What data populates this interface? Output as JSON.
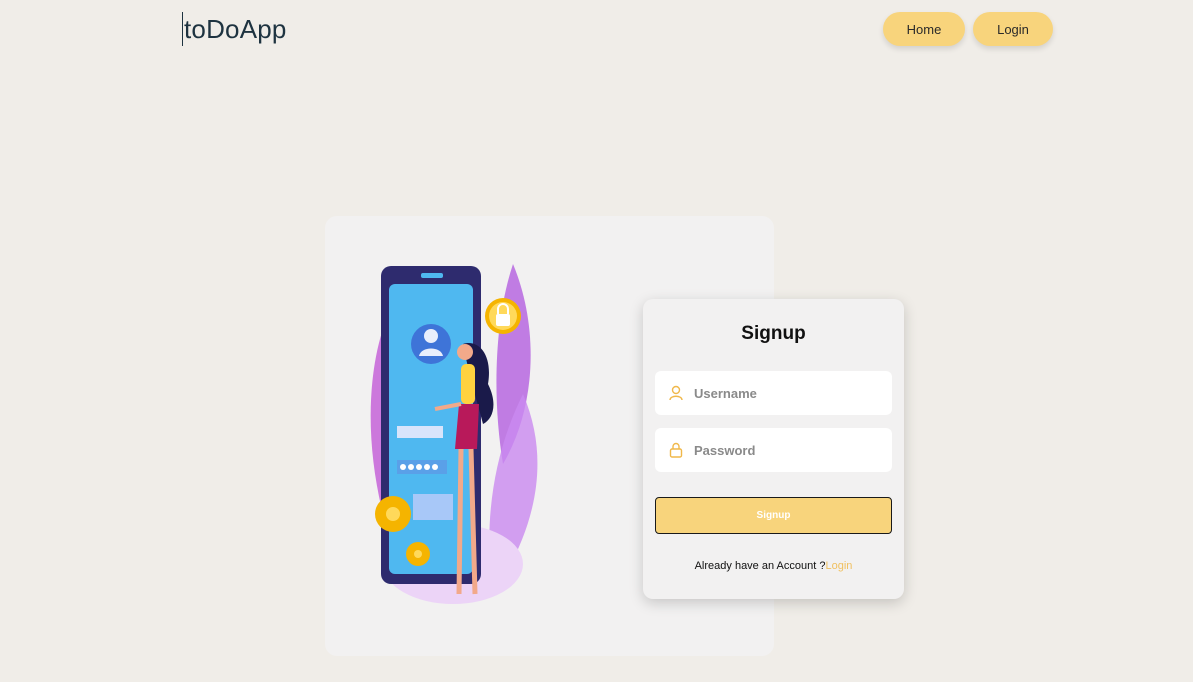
{
  "header": {
    "brand": "toDoApp",
    "nav": {
      "home_label": "Home",
      "login_label": "Login"
    }
  },
  "signup_form": {
    "title": "Signup",
    "username": {
      "placeholder": "Username",
      "value": "",
      "icon": "user-icon"
    },
    "password": {
      "placeholder": "Password",
      "value": "",
      "icon": "lock-icon"
    },
    "submit_label": "Signup",
    "alt_prompt": "Already have an Account ?",
    "alt_link_label": "Login"
  },
  "colors": {
    "background": "#f0ede8",
    "card": "#f2f1f1",
    "accent": "#f8d47c",
    "link": "#f0c060",
    "brand_text": "#1e3340"
  }
}
